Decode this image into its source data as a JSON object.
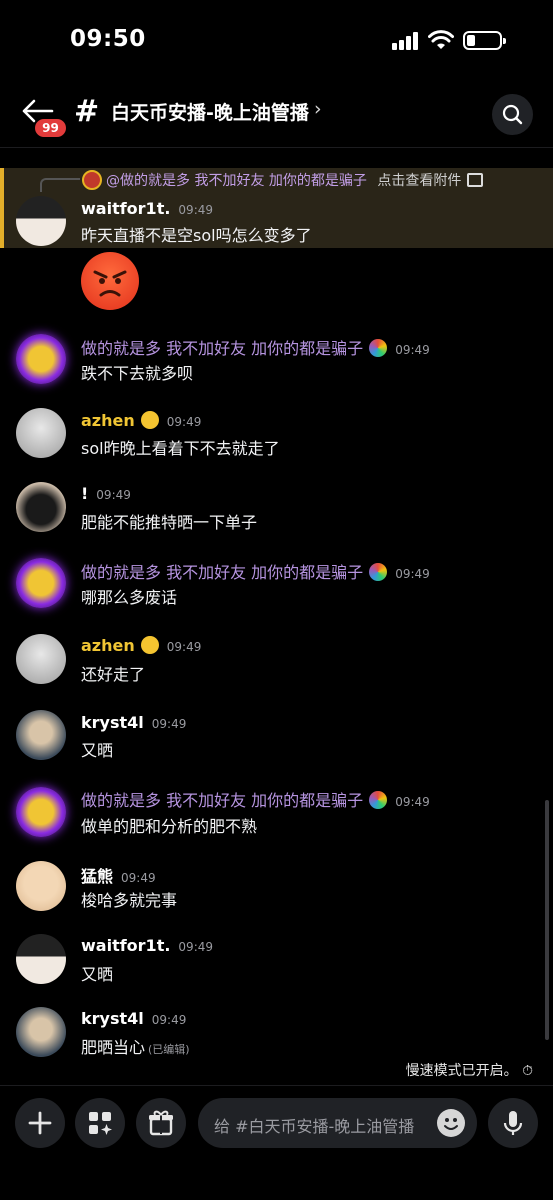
{
  "status": {
    "time": "09:50"
  },
  "header": {
    "badge": "99",
    "hash": "#",
    "title": "白天币安播-晚上油管播",
    "chevron": "›"
  },
  "reply": {
    "mention": "@做的就是多 我不加好友 加你的都是骗子",
    "attachment": "点击查看附件"
  },
  "messages": [
    {
      "name": "waitfor1t.",
      "time": "09:49",
      "text": "昨天直播不是空sol吗怎么变多了",
      "name_color": "#ffffff"
    },
    {
      "name": "做的就是多 我不加好友 加你的都是骗子",
      "time": "09:49",
      "text": "跌不下去就多呗",
      "name_color": "#b694e0"
    },
    {
      "name": "azhen",
      "time": "09:49",
      "text": "sol昨晚上看着下不去就走了",
      "name_color": "#f0c534"
    },
    {
      "name": "!",
      "time": "09:49",
      "text": "肥能不能推特晒一下单子",
      "name_color": "#ffffff"
    },
    {
      "name": "做的就是多 我不加好友 加你的都是骗子",
      "time": "09:49",
      "text": "哪那么多废话",
      "name_color": "#b694e0"
    },
    {
      "name": "azhen",
      "time": "09:49",
      "text": "还好走了",
      "name_color": "#f0c534"
    },
    {
      "name": "kryst4l",
      "time": "09:49",
      "text": "又晒",
      "name_color": "#ffffff"
    },
    {
      "name": "做的就是多 我不加好友 加你的都是骗子",
      "time": "09:49",
      "text": "做单的肥和分析的肥不熟",
      "name_color": "#b694e0"
    },
    {
      "name": "猛熊",
      "time": "09:49",
      "text": "梭哈多就完事",
      "name_color": "#ffffff"
    },
    {
      "name": "waitfor1t.",
      "time": "09:49",
      "text": "又晒",
      "name_color": "#ffffff"
    },
    {
      "name": "kryst4l",
      "time": "09:49",
      "text": "肥晒当心",
      "name_color": "#ffffff",
      "edited": "(已编辑)"
    }
  ],
  "slowmode": "慢速模式已开启。",
  "composer": {
    "placeholder": "给 #白天币安播-晚上油管播"
  },
  "colors": {
    "accent_mention": "#e2ae2a",
    "badge": "#e23b3b"
  }
}
